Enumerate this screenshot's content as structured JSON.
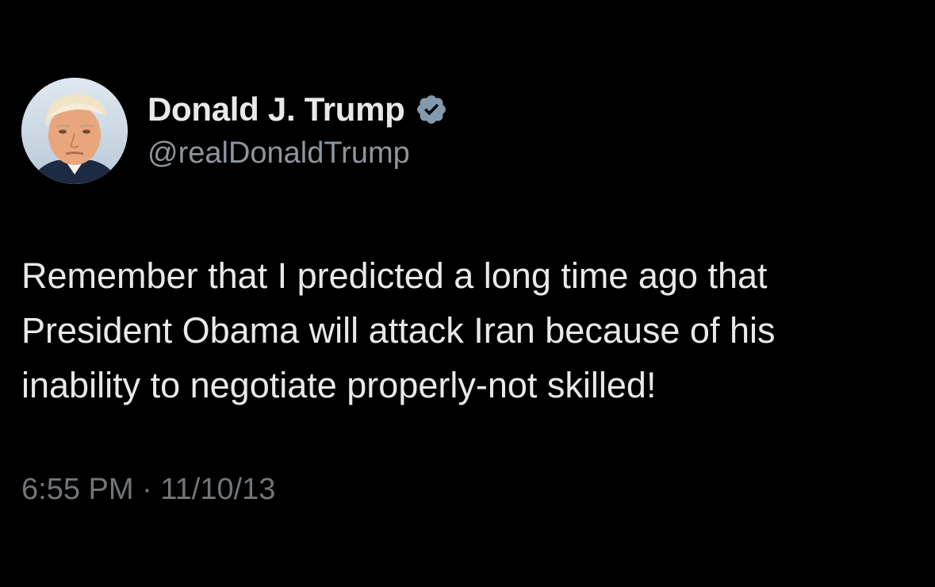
{
  "author": {
    "display_name": "Donald J. Trump",
    "handle": "@realDonaldTrump",
    "verified": true,
    "verified_icon": "verified-badge-icon",
    "avatar": "profile-photo"
  },
  "tweet": {
    "lines": [
      "Remember that I predicted a long time ago that",
      "President Obama will attack Iran because of his",
      "inability to negotiate properly-not skilled!"
    ],
    "time": "6:55 PM",
    "separator": "·",
    "date": "11/10/13"
  },
  "colors": {
    "background": "#000000",
    "text_primary": "#e7e9ea",
    "text_secondary": "#71767b",
    "verified_badge": "#829aab"
  }
}
